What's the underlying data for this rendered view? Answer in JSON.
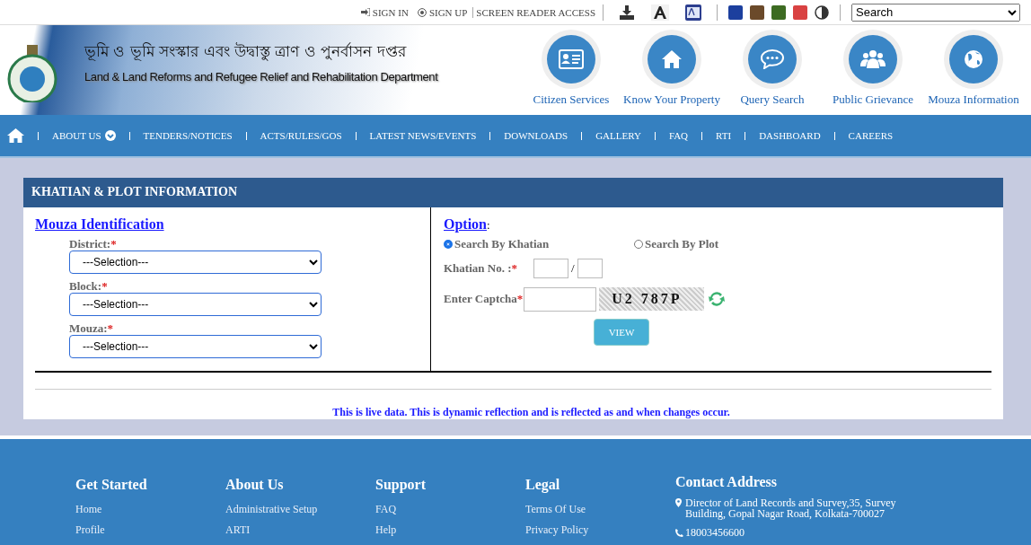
{
  "top_bar": {
    "links": [
      {
        "kind": "sign-in",
        "label": "SIGN IN"
      },
      {
        "kind": "sign-up",
        "label": "SIGN UP"
      },
      {
        "kind": "plain",
        "label": "SCREEN READER ACCESS"
      }
    ],
    "theme_colors": [
      {
        "color": "#1c3f9e"
      },
      {
        "color": "#6b4a2a"
      },
      {
        "color": "#3d6b22"
      },
      {
        "color": "#d94242"
      }
    ],
    "search": {
      "value": "Search"
    }
  },
  "header": {
    "title_bn": "ভূমি ও ভূমি সংস্কার এবং উদ্বাস্তু ত্রাণ ও পুনর্বাসন দপ্তর",
    "title_en": "Land & Land Reforms and Refugee Relief and Rehabilitation Department",
    "quick_links": [
      {
        "kind": "id-card",
        "label": "Citizen Services"
      },
      {
        "kind": "house",
        "label": "Know Your Property"
      },
      {
        "kind": "chat",
        "label": "Query Search"
      },
      {
        "kind": "people",
        "label": "Public Grievance"
      },
      {
        "kind": "globe",
        "label": "Mouza Information"
      }
    ]
  },
  "nav": {
    "items": [
      {
        "kind": "home"
      },
      {
        "kind": "dropdown",
        "label": "ABOUT US"
      },
      {
        "kind": "link",
        "label": "TENDERS/NOTICES"
      },
      {
        "kind": "link",
        "label": "ACTS/RULES/GOS"
      },
      {
        "kind": "link",
        "label": "LATEST NEWS/EVENTS"
      },
      {
        "kind": "link",
        "label": "DOWNLOADS"
      },
      {
        "kind": "link",
        "label": "GALLERY"
      },
      {
        "kind": "link",
        "label": "FAQ"
      },
      {
        "kind": "link",
        "label": "RTI"
      },
      {
        "kind": "link",
        "label": "DASHBOARD"
      },
      {
        "kind": "link",
        "label": "CAREERS"
      }
    ]
  },
  "panel": {
    "title": "KHATIAN & PLOT INFORMATION",
    "left_heading": "Mouza Identification",
    "fields": [
      {
        "label": "District:",
        "mark": "*",
        "value": "---Selection---"
      },
      {
        "label": "Block:",
        "mark": "*",
        "value": "---Selection---"
      },
      {
        "label": "Mouza:",
        "mark": "*",
        "value": "---Selection---"
      }
    ],
    "right_heading": "Option",
    "right_heading_suffix": ":",
    "search_options": [
      {
        "label": "Search By Khatian",
        "selected": true
      },
      {
        "label": "Search By Plot",
        "selected": false
      }
    ],
    "khatian_label": "Khatian No. :",
    "khatian_mark": "*",
    "separator": "/",
    "captcha_label": "Enter Captcha",
    "captcha_mark": "*",
    "captcha_text": "U2 787P",
    "button": "VIEW",
    "note": "This is live data. This is dynamic reflection and is reflected as and when changes occur."
  },
  "footer": {
    "columns": [
      {
        "heading": "Get Started",
        "links": [
          "Home",
          "Profile"
        ]
      },
      {
        "heading": "About Us",
        "links": [
          "Administrative Setup",
          "ARTI"
        ]
      },
      {
        "heading": "Support",
        "links": [
          "FAQ",
          "Help"
        ]
      },
      {
        "heading": "Legal",
        "links": [
          "Terms Of Use",
          "Privacy Policy"
        ]
      }
    ],
    "contact": {
      "heading": "Contact Address",
      "address": "Director of Land Records and Survey,35, Survey Building, Gopal Nagar Road, Kolkata-700027",
      "phone": "18003456600"
    }
  }
}
